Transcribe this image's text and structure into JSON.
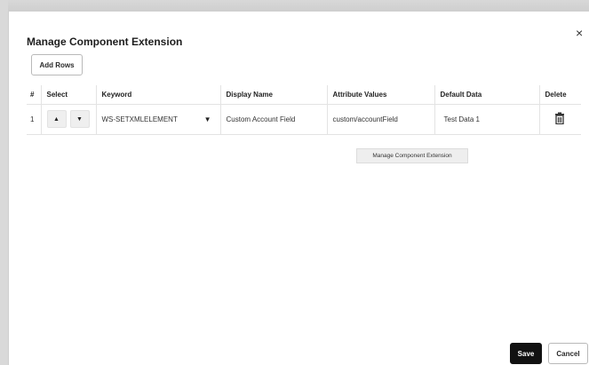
{
  "dialog": {
    "title": "Manage Component Extension",
    "close_glyph": "×",
    "add_rows_label": "Add Rows",
    "save_label": "Save",
    "cancel_label": "Cancel",
    "tooltip": "Manage Component Extension"
  },
  "table": {
    "headers": [
      "#",
      "Select",
      "Keyword",
      "Display Name",
      "Attribute Values",
      "Default Data",
      "Delete"
    ],
    "rows": [
      {
        "num": "1",
        "up_glyph": "▲",
        "down_glyph": "▼",
        "keyword": "WS-SETXMLELEMENT",
        "display_name": "Custom Account Field",
        "attribute_values": "custom/accountField",
        "default_data": "Test Data 1",
        "delete_icon": "trash-icon"
      }
    ]
  },
  "icons": {
    "dropdown": "▼"
  }
}
